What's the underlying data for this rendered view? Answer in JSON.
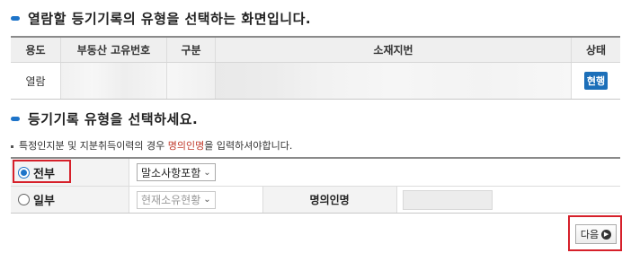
{
  "section1": {
    "title": "열람할 등기기록의 유형을 선택하는 화면입니다."
  },
  "table1": {
    "headers": [
      "용도",
      "부동산 고유번호",
      "구분",
      "소재지번",
      "상태"
    ],
    "row": {
      "purpose": "열람",
      "status": "현행"
    }
  },
  "section2": {
    "title": "등기기록 유형을 선택하세요."
  },
  "note": {
    "prefix": "특정인지분 및 지분취득이력의 경우 ",
    "highlight": "명의인명",
    "suffix": "을 입력하셔야합니다."
  },
  "options": {
    "full": {
      "label": "전부",
      "selected": true,
      "select_value": "말소사항포함"
    },
    "partial": {
      "label": "일부",
      "selected": false,
      "select_value": "현재소유현황",
      "field_label": "명의인명",
      "field_value": ""
    }
  },
  "next_button": {
    "label": "다음"
  },
  "colors": {
    "accent": "#1e74c9",
    "highlight_box": "#d6202a",
    "status_badge": "#1c6fb9"
  }
}
